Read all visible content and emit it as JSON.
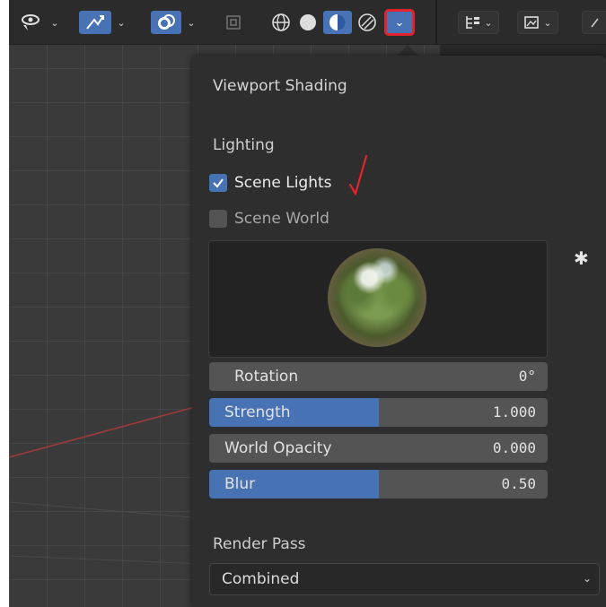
{
  "popover": {
    "title": "Viewport Shading",
    "lighting_label": "Lighting",
    "scene_lights": {
      "label": "Scene Lights",
      "checked": true
    },
    "scene_world": {
      "label": "Scene World",
      "checked": false
    },
    "sliders": [
      {
        "label": "Rotation",
        "value": "0°",
        "fill": 0
      },
      {
        "label": "Strength",
        "value": "1.000",
        "fill": 0.5
      },
      {
        "label": "World Opacity",
        "value": "0.000",
        "fill": 0
      },
      {
        "label": "Blur",
        "value": "0.50",
        "fill": 0.5
      }
    ],
    "render_pass_label": "Render Pass",
    "render_pass_value": "Combined"
  },
  "colors": {
    "accent": "#4772b3",
    "highlight_box": "#e0232d",
    "annotation_check": "#e8232d"
  },
  "icons": [
    "view-object-icon",
    "gizmo-icon",
    "overlay-icon",
    "xray-icon",
    "wireframe-shading-icon",
    "solid-shading-icon",
    "material-preview-icon",
    "rendered-shading-icon",
    "shading-dropdown-icon",
    "outliner-filter-icon",
    "display-mode-icon",
    "settings-gear-icon"
  ]
}
